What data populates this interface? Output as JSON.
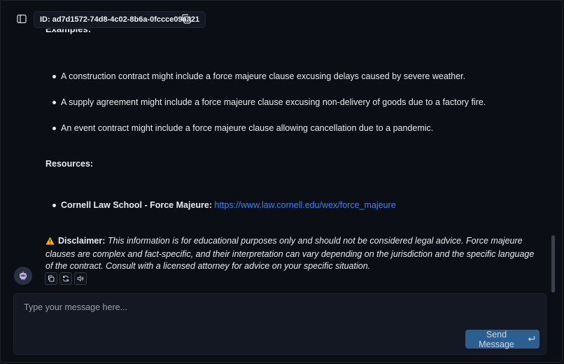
{
  "header": {
    "chat_id": "ID: ad7d1572-74d8-4c02-8b6a-0fccce09aa21",
    "icons": [
      "sidebar-toggle-icon",
      "copy-icon"
    ]
  },
  "message": {
    "partial_heading": "Examples:",
    "examples": [
      "A construction contract might include a force majeure clause excusing delays caused by severe weather.",
      "A supply agreement might include a force majeure clause excusing non-delivery of goods due to a factory fire.",
      "An event contract might include a force majeure clause allowing cancellation due to a pandemic."
    ],
    "resources_heading": "Resources:",
    "resource": {
      "label": "Cornell Law School - Force Majeure:",
      "url": "https://www.law.cornell.edu/wex/force_majeure"
    },
    "disclaimer_label": "Disclaimer:",
    "disclaimer_text": "This information is for educational purposes only and should not be considered legal advice. Force majeure clauses are complex and fact-specific, and their interpretation can vary depending on the jurisdiction and the specific language of the contract. Consult with a licensed attorney for advice on your specific situation.",
    "actions": [
      "copy-icon",
      "regenerate-icon",
      "speaker-icon"
    ]
  },
  "composer": {
    "placeholder": "Type your message here...",
    "send_label": "Send Message"
  },
  "colors": {
    "background": "#0b0e14",
    "link": "#3b82f6",
    "send_button": "#2c5f8f",
    "warning": "#f5b400"
  }
}
